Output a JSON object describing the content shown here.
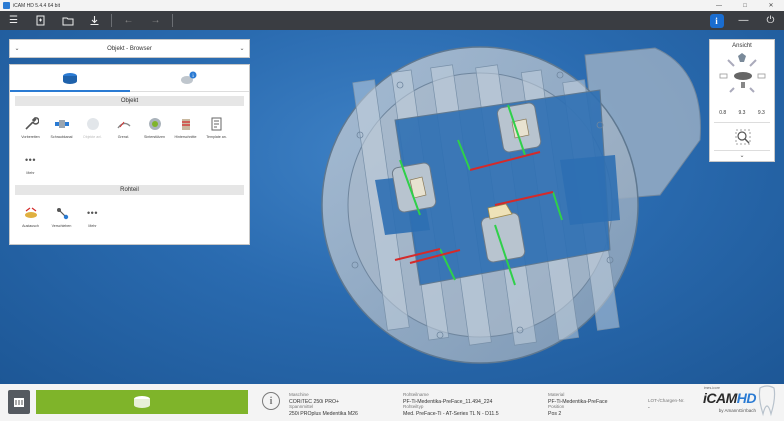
{
  "window": {
    "title": "iCAM HD 5.4.4 64 bit"
  },
  "toolbar": {
    "buttons": [
      "menu-icon",
      "new-file-icon",
      "open-folder-icon",
      "download-icon",
      "back-arrow-icon",
      "forward-arrow-icon",
      "info-icon",
      "minimize-icon",
      "power-icon"
    ],
    "info_label": "i"
  },
  "browser": {
    "header": "Objekt - Browser",
    "sections": {
      "objekt": {
        "title": "Objekt",
        "tools": [
          {
            "label": "Vorbereiten",
            "icon": "wrench-icon",
            "enabled": true
          },
          {
            "label": "Schraubkanal",
            "icon": "screw-channel-icon",
            "enabled": true
          },
          {
            "label": "Objekte anl.",
            "icon": "object-icon",
            "enabled": false
          },
          {
            "label": "Grenzl.",
            "icon": "boundary-icon",
            "enabled": true
          },
          {
            "label": "Sinterstützen",
            "icon": "sinter-support-icon",
            "enabled": true
          },
          {
            "label": "Hinterschnitte",
            "icon": "undercut-icon",
            "enabled": true
          },
          {
            "label": "Template an.",
            "icon": "template-icon",
            "enabled": true
          },
          {
            "label": "Mehr",
            "icon": "more-icon",
            "enabled": true
          }
        ]
      },
      "rohteil": {
        "title": "Rohteil",
        "tools": [
          {
            "label": "Austausch",
            "icon": "exchange-icon",
            "enabled": true
          },
          {
            "label": "Verschieben",
            "icon": "move-icon",
            "enabled": true
          },
          {
            "label": "Mehr",
            "icon": "more-icon",
            "enabled": true
          }
        ]
      }
    }
  },
  "view_widget": {
    "title": "Ansicht",
    "values": [
      "0.8",
      "9.3",
      "9.3"
    ]
  },
  "status": {
    "maschine_label": "Maschine",
    "maschine_value": "CORiTEC 250i PRO+",
    "spannmittel_label": "Spannmittel",
    "spannmittel_value": "250i PROplus Medentika M26",
    "rohteilname_label": "Rohteilname",
    "rohteilname_value": "PF-Ti-Medentika-PreFace_11.494_224",
    "rohteiltyp_label": "Rohteiltyp",
    "rohteiltyp_value": "Med. PreFace-Ti - AT-Series TL N - D11.5",
    "material_label": "Material",
    "material_value": "PF-Ti-Medentika-PreFace",
    "position_label": "Position",
    "position_value": "Pos 2",
    "lot_label": "LOT-/Chargen-Nr.",
    "lot_value": "-"
  },
  "logo": {
    "brand_prefix": "iCAM",
    "brand_suffix": "HD",
    "by": "by AmannGirrbach",
    "tag": "imes-icore"
  },
  "colors": {
    "accent": "#2b7bd3",
    "primary_action": "#7fb42a",
    "toolbar": "#3a3d42",
    "viewport": "#2a6bb0"
  }
}
